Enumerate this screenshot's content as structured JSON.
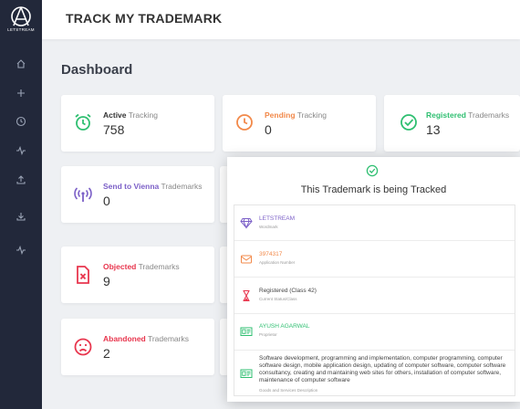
{
  "app": {
    "title": "TRACK MY TRADEMARK",
    "logo_text": "LETSTREAM"
  },
  "sidebar": {
    "items": [
      {
        "icon": "home-icon"
      },
      {
        "icon": "plus-icon"
      },
      {
        "icon": "clock-icon"
      },
      {
        "icon": "activity-icon"
      },
      {
        "icon": "upload-icon"
      },
      {
        "icon": "download-icon"
      },
      {
        "icon": "activity-icon"
      }
    ]
  },
  "dashboard": {
    "title": "Dashboard",
    "cards": [
      {
        "status": "Active",
        "suffix": " Tracking",
        "value": "758",
        "color": "#2fbf71",
        "icon": "alarm-clock-icon"
      },
      {
        "status": "Pending",
        "suffix": " Tracking",
        "value": "0",
        "color": "#f2894a",
        "icon": "clock-icon"
      },
      {
        "status": "Registered",
        "suffix": " Trademarks",
        "value": "13",
        "color": "#2fbf71",
        "icon": "check-circle-icon"
      },
      {
        "status": "Send to Vienna",
        "suffix": " Trademarks",
        "value": "0",
        "color": "#7b5fc7",
        "icon": "broadcast-icon"
      },
      {
        "status": "Objected",
        "suffix": " Trademarks",
        "value": "9",
        "color": "#e8364e",
        "icon": "file-x-icon"
      },
      {
        "status": "Abandoned",
        "suffix": " Trademarks",
        "value": "2",
        "color": "#e8364e",
        "icon": "frown-icon"
      }
    ]
  },
  "modal": {
    "title": "This Trademark is being Tracked",
    "rows": [
      {
        "value": "LETSTREAM",
        "label": "Wordmark",
        "color": "#7b5fc7",
        "icon": "diamond-icon"
      },
      {
        "value": "3974317",
        "label": "Application Number",
        "color": "#f2894a",
        "icon": "envelope-icon"
      },
      {
        "value": "Registered (Class 42)",
        "label": "Current Status/Class",
        "color": "#444444",
        "icon": "hourglass-icon"
      },
      {
        "value": "AYUSH AGARWAL",
        "label": "Proprietor",
        "color": "#2fbf71",
        "icon": "id-card-icon"
      },
      {
        "value": "Software development, programming and implementation, computer programming, computer software design, mobile application design, updating of computer software, computer software consultancy, creating and maintaining web sites for others, installation of computer software, maintenance of computer software",
        "label": "Goods and Services Description",
        "color": "#444444",
        "icon": "id-card-icon"
      }
    ]
  }
}
